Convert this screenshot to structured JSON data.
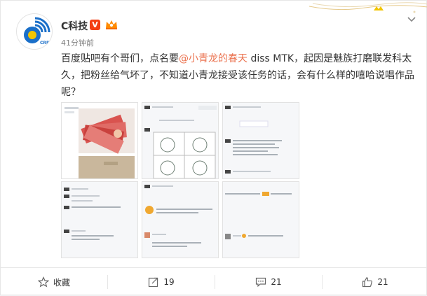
{
  "post": {
    "user_name": "C科技",
    "verified_mark": "V",
    "time": "41分钟前",
    "text_part1": "百度贴吧有个哥们，点名要",
    "mention": "@小青龙的春天",
    "text_part2": " diss MTK，起因是魅族打磨联发科太久，把粉丝给气坏了，不知道小青龙接受该任务的话，会有什么样的嘻哈说唱作品呢？",
    "avatar_label": "CRP"
  },
  "images": [
    {
      "name": "image-money-photo"
    },
    {
      "name": "image-comic-chat"
    },
    {
      "name": "image-chat-screenshot-1"
    },
    {
      "name": "image-chat-screenshot-2"
    },
    {
      "name": "image-chat-screenshot-3"
    },
    {
      "name": "image-chat-screenshot-4"
    }
  ],
  "actions": {
    "favorite_label": "收藏",
    "repost_count": "19",
    "comment_count": "21",
    "like_count": "21"
  },
  "colors": {
    "mention": "#eb7350",
    "verified": "#f43e14",
    "avatar_blue": "#1a6fc9",
    "avatar_yellow": "#f2c500"
  }
}
